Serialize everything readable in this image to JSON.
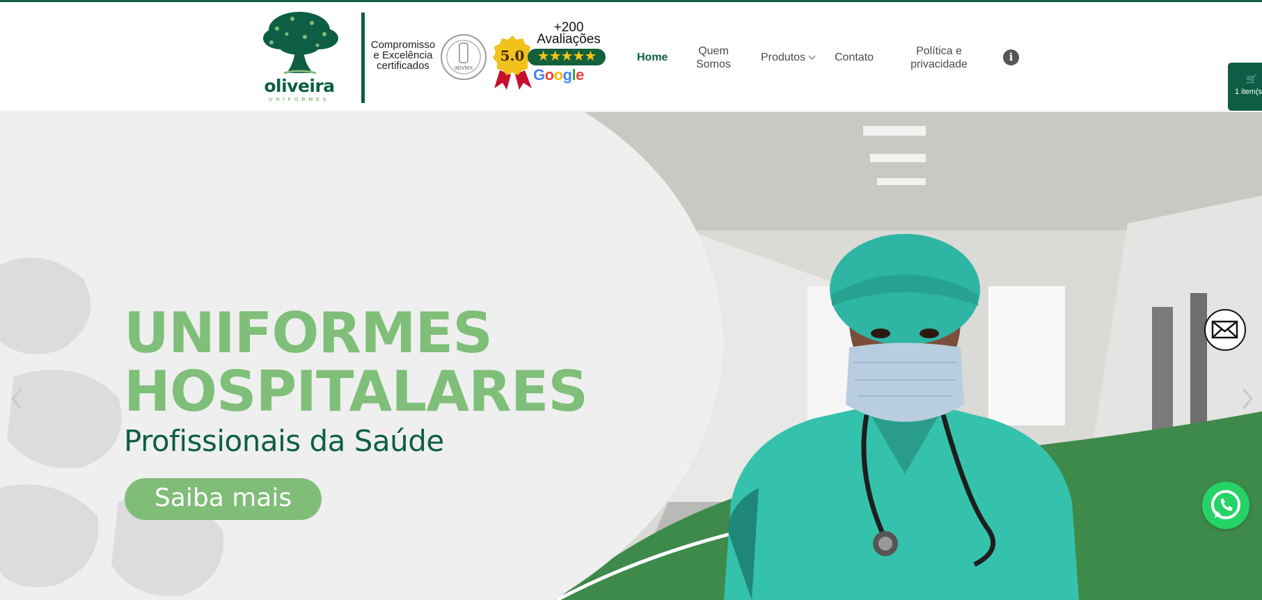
{
  "header": {
    "logo": {
      "wordmark": "oliveira",
      "tagline": "UNIFORMES"
    },
    "certification": {
      "text_lines": [
        "Compromisso",
        "e Excelência",
        "certificados"
      ],
      "seal_text": "abvtex"
    },
    "google_badge": {
      "reviews_lines": [
        "+200",
        "Avaliações"
      ],
      "rating": "5.0",
      "stars": "★★★★★",
      "brand": "Google"
    },
    "nav": {
      "home": "Home",
      "quem_somos_lines": [
        "Quem",
        "Somos"
      ],
      "produtos": "Produtos",
      "contato": "Contato",
      "politica_lines": [
        "Política e",
        "privacidade"
      ]
    },
    "info_icon": "info-icon",
    "cart": {
      "count_label": "1 item(s",
      "icon": "cart-icon"
    }
  },
  "hero": {
    "title_lines": [
      "UNIFORMES",
      "HOSPITALARES"
    ],
    "subtitle": "Profissionais da Saúde",
    "button_label": "Saiba mais",
    "arrows": [
      "chevron-left-icon",
      "chevron-right-icon"
    ]
  },
  "floating": {
    "mail": "mail-icon",
    "whatsapp": "whatsapp-icon"
  },
  "colors": {
    "brand_green": "#0d5e45",
    "light_green": "#7fbf79",
    "whatsapp": "#25d366"
  }
}
